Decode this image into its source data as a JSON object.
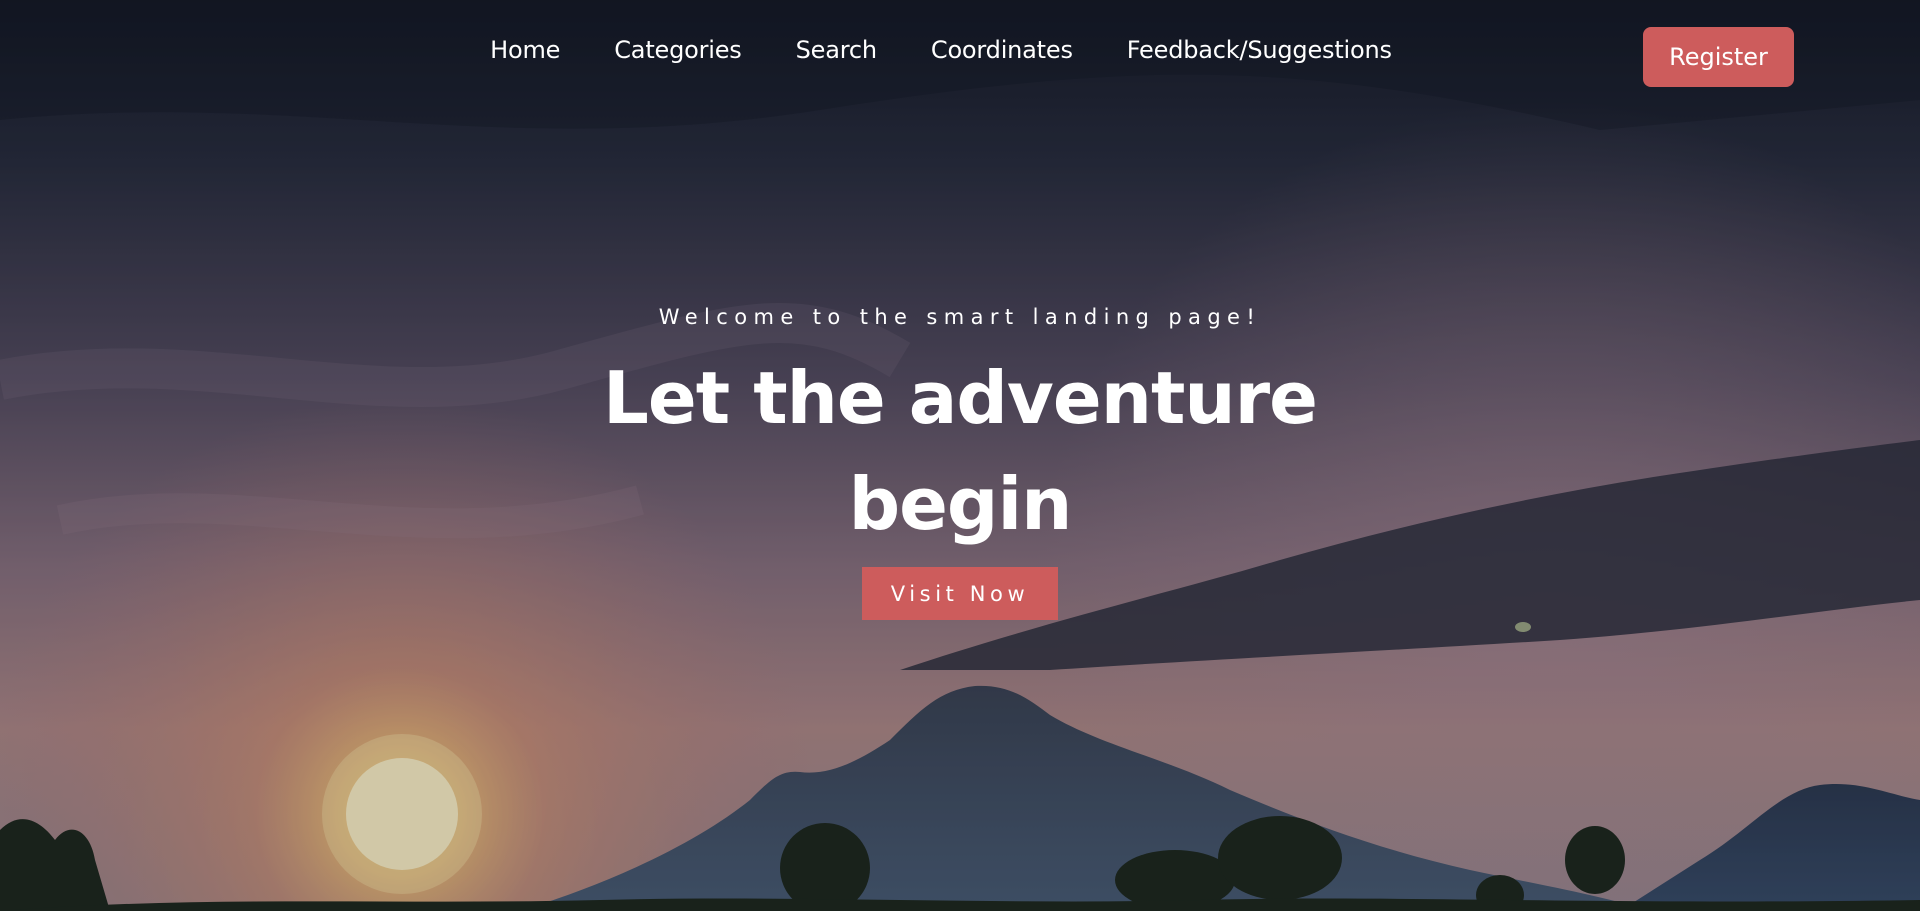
{
  "nav": {
    "items": [
      {
        "label": "Home"
      },
      {
        "label": "Categories"
      },
      {
        "label": "Search"
      },
      {
        "label": "Coordinates"
      },
      {
        "label": "Feedback/Suggestions"
      }
    ],
    "register_label": "Register"
  },
  "hero": {
    "tagline": "Welcome to the smart landing page!",
    "headline_line1": "Let the adventure",
    "headline_line2": "begin",
    "cta_label": "Visit Now"
  },
  "colors": {
    "accent": "#cd5c5c",
    "text": "#ffffff",
    "sky_top": "#1a1f2e",
    "sunset": "#e8a27a"
  }
}
